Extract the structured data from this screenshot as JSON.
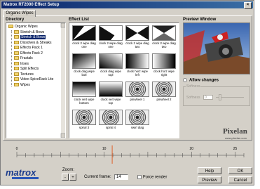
{
  "window": {
    "title": "Matrox RT2000 Effect Setup",
    "close_glyph": "×"
  },
  "tabs": [
    {
      "label": "Organic Wipes"
    }
  ],
  "directory": {
    "label": "Directory",
    "items": [
      {
        "label": "Organic Wipes",
        "level": 0,
        "selected": false
      },
      {
        "label": "Stretch & Bows",
        "level": 1,
        "selected": false
      },
      {
        "label": "Stretch & Bows",
        "level": 1,
        "selected": true
      },
      {
        "label": "Dissolves & Streaks",
        "level": 1,
        "selected": false
      },
      {
        "label": "Effects Pack 1",
        "level": 1,
        "selected": false
      },
      {
        "label": "Effects Pack 2",
        "level": 1,
        "selected": false
      },
      {
        "label": "Fractals",
        "level": 1,
        "selected": false
      },
      {
        "label": "Irises",
        "level": 1,
        "selected": false
      },
      {
        "label": "Split Effects",
        "level": 1,
        "selected": false
      },
      {
        "label": "Textures",
        "level": 1,
        "selected": false
      },
      {
        "label": "Video SpiceRack Lite",
        "level": 1,
        "selected": false
      },
      {
        "label": "Wipes",
        "level": 1,
        "selected": false
      }
    ]
  },
  "effects": {
    "label": "Effect List",
    "items": [
      {
        "label": "clock 2 wipe diag one",
        "pattern": "diag-bl"
      },
      {
        "label": "clock 2 wipe diag one",
        "pattern": "diag-tr"
      },
      {
        "label": "clock 2 wipe diag two",
        "pattern": "bowtie"
      },
      {
        "label": "clock 2 wipe diag two",
        "pattern": "bowtie-gray"
      },
      {
        "label": "clock diag wipe botl",
        "pattern": "grad-tl"
      },
      {
        "label": "clock diag wipe topl",
        "pattern": "grad-bl"
      },
      {
        "label": "clock horz wipe left",
        "pattern": "grad-h"
      },
      {
        "label": "clock horz wipe right",
        "pattern": "grad-hr"
      },
      {
        "label": "clock vert wipe bottom",
        "pattern": "grad-v"
      },
      {
        "label": "clock vert wipe top",
        "pattern": "grad-vr"
      },
      {
        "label": "pinwheel 1",
        "pattern": "spiral"
      },
      {
        "label": "pinwheel 2",
        "pattern": "spiral-2"
      },
      {
        "label": "spiral 3",
        "pattern": "spiral-3"
      },
      {
        "label": "spiral 4",
        "pattern": "spiral-4"
      },
      {
        "label": "swirl diag",
        "pattern": "spiral-5"
      }
    ]
  },
  "preview": {
    "label": "Preview Window"
  },
  "controls": {
    "allow_changes": "Allow changes",
    "group_label": "Softness",
    "softness_label": "Softness",
    "softness_value": "0",
    "brand_name": "Pixelan",
    "brand_url": "www.pixelan.com"
  },
  "timeline": {
    "ticks": [
      "0",
      "10",
      "20",
      "25"
    ],
    "current_position": 0.42
  },
  "footer": {
    "brand": "matrox",
    "zoom_label": "Zoom:",
    "zoom_minus": "-",
    "zoom_plus": "+",
    "current_frame_label": "Current frame:",
    "current_frame_value": "14",
    "force_render_label": "Force render",
    "help_label": "Help",
    "ok_label": "OK",
    "preview_label": "Preview",
    "cancel_label": "Cancel"
  },
  "colors": {
    "accent": "#0a246a",
    "timeline_marker": "#e0602a",
    "logo": "#1c3c8c"
  }
}
